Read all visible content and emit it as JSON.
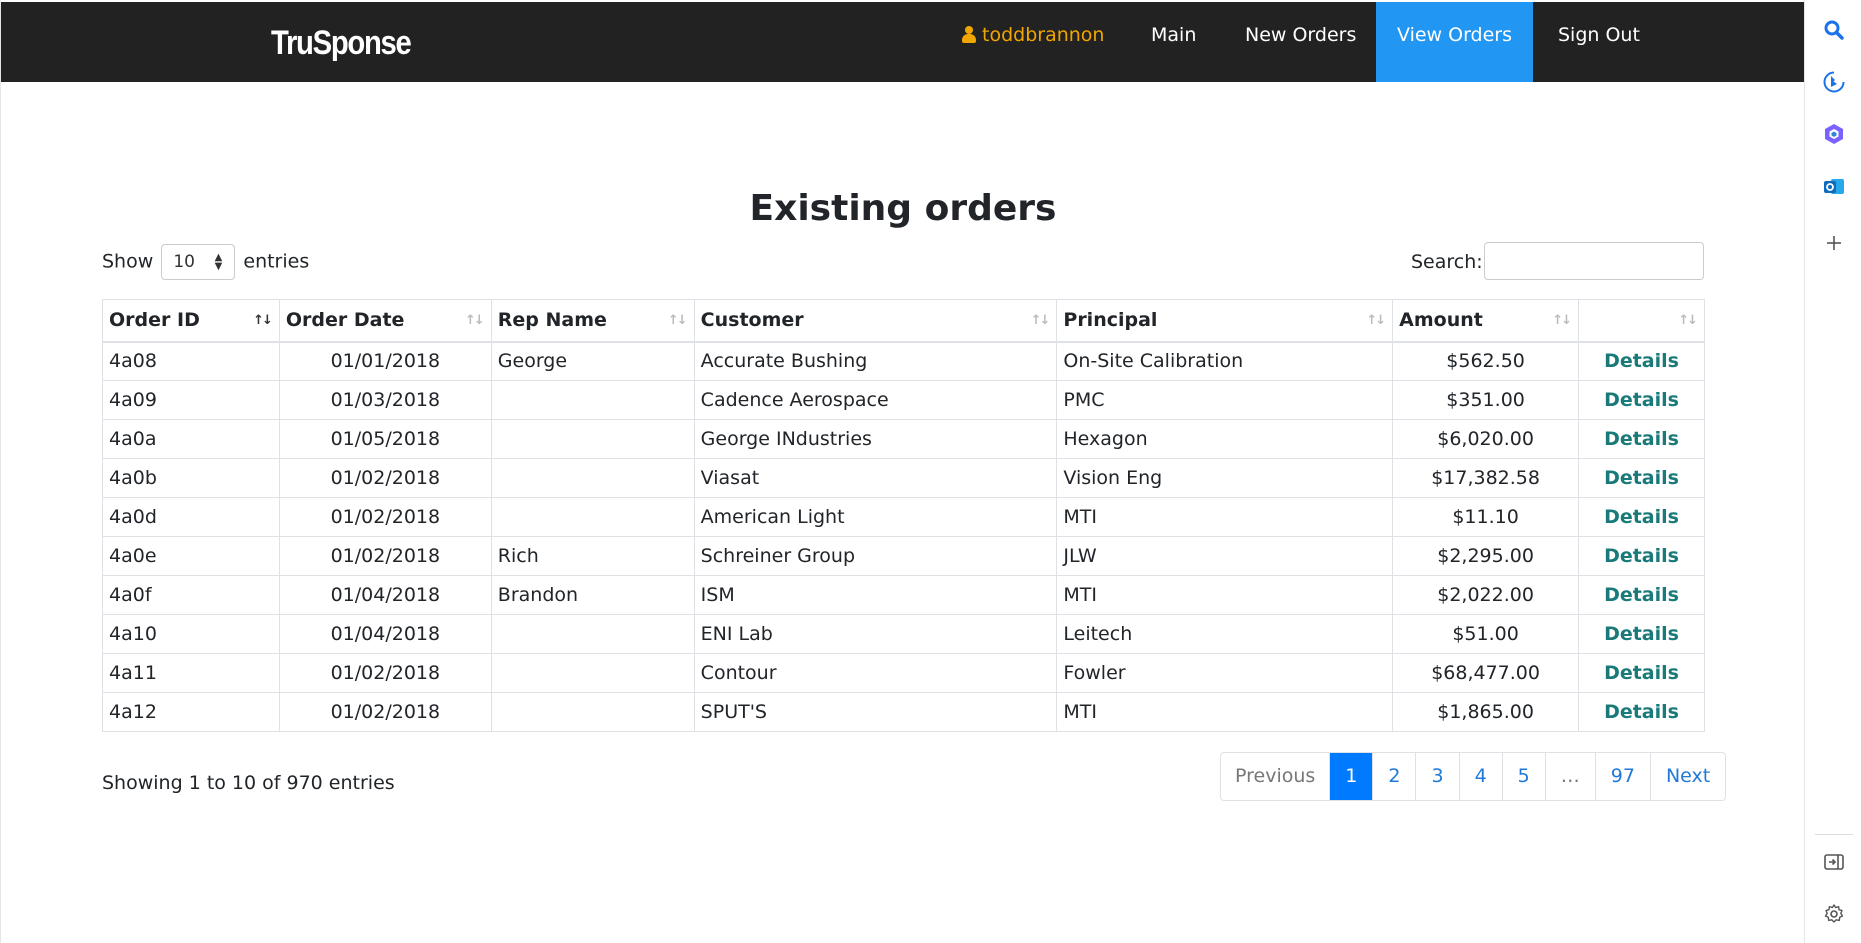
{
  "navbar": {
    "brand": "TruSponse",
    "user": "toddbrannon",
    "items": [
      "Main",
      "New Orders",
      "View Orders",
      "Sign Out"
    ],
    "active_item": "View Orders"
  },
  "page": {
    "title": "Existing orders"
  },
  "controls": {
    "show_label": "Show",
    "entries_value": "10",
    "entries_label": "entries",
    "search_label": "Search:",
    "search_value": ""
  },
  "table": {
    "columns": [
      "Order ID",
      "Order Date",
      "Rep Name",
      "Customer",
      "Principal",
      "Amount",
      ""
    ],
    "sorted_column": "Order ID",
    "rows": [
      {
        "id": "4a08",
        "date": "01/01/2018",
        "rep": "George",
        "customer": "Accurate Bushing",
        "principal": "On-Site Calibration",
        "amount": "$562.50",
        "action": "Details"
      },
      {
        "id": "4a09",
        "date": "01/03/2018",
        "rep": "",
        "customer": "Cadence Aerospace",
        "principal": "PMC",
        "amount": "$351.00",
        "action": "Details"
      },
      {
        "id": "4a0a",
        "date": "01/05/2018",
        "rep": "",
        "customer": "George INdustries",
        "principal": "Hexagon",
        "amount": "$6,020.00",
        "action": "Details"
      },
      {
        "id": "4a0b",
        "date": "01/02/2018",
        "rep": "",
        "customer": "Viasat",
        "principal": "Vision Eng",
        "amount": "$17,382.58",
        "action": "Details"
      },
      {
        "id": "4a0d",
        "date": "01/02/2018",
        "rep": "",
        "customer": "American Light",
        "principal": "MTI",
        "amount": "$11.10",
        "action": "Details"
      },
      {
        "id": "4a0e",
        "date": "01/02/2018",
        "rep": "Rich",
        "customer": "Schreiner Group",
        "principal": "JLW",
        "amount": "$2,295.00",
        "action": "Details"
      },
      {
        "id": "4a0f",
        "date": "01/04/2018",
        "rep": "Brandon",
        "customer": "ISM",
        "principal": "MTI",
        "amount": "$2,022.00",
        "action": "Details"
      },
      {
        "id": "4a10",
        "date": "01/04/2018",
        "rep": "",
        "customer": "ENI Lab",
        "principal": "Leitech",
        "amount": "$51.00",
        "action": "Details"
      },
      {
        "id": "4a11",
        "date": "01/02/2018",
        "rep": "",
        "customer": "Contour",
        "principal": "Fowler",
        "amount": "$68,477.00",
        "action": "Details"
      },
      {
        "id": "4a12",
        "date": "01/02/2018",
        "rep": "",
        "customer": "SPUT'S",
        "principal": "MTI",
        "amount": "$1,865.00",
        "action": "Details"
      }
    ]
  },
  "footer": {
    "info": "Showing 1 to 10 of 970 entries",
    "pagination": [
      "Previous",
      "1",
      "2",
      "3",
      "4",
      "5",
      "…",
      "97",
      "Next"
    ],
    "active_page": "1"
  },
  "sidebar": {
    "icons": [
      "search-icon",
      "bing-icon",
      "copilot-icon",
      "outlook-icon",
      "add-icon",
      "sidebar-toggle-icon",
      "settings-icon"
    ],
    "colors": {
      "blue": "#1a73e8",
      "outlook": "#0f6cbd"
    }
  },
  "colors": {
    "navbar_bg": "#222222",
    "active_nav": "#2196f3",
    "user_link": "#f0a500",
    "details_link": "#1a7a7a",
    "active_page": "#007bff"
  }
}
